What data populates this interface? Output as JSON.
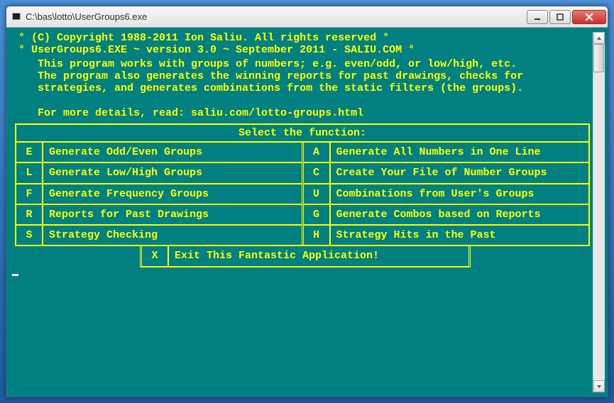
{
  "window": {
    "title": "C:\\bas\\lotto\\UserGroups6.exe"
  },
  "copyright": " ° (C) Copyright 1988-2011 Ion Saliu. All rights reserved °\n ° UserGroups6.EXE ~ version 3.0 ~ September 2011 - SALIU.COM °",
  "description": "    This program works with groups of numbers; e.g. even/odd, or low/high, etc.\n    The program also generates the winning reports for past drawings, checks for\n    strategies, and generates combinations from the static filters (the groups).\n\n    For more details, read: saliu.com/lotto-groups.html",
  "menu": {
    "header": "Select the function:",
    "left": [
      {
        "key": "E",
        "label": "Generate Odd/Even Groups"
      },
      {
        "key": "L",
        "label": "Generate Low/High Groups"
      },
      {
        "key": "F",
        "label": "Generate Frequency Groups"
      },
      {
        "key": "R",
        "label": "Reports for Past Drawings"
      },
      {
        "key": "S",
        "label": "Strategy Checking"
      }
    ],
    "right": [
      {
        "key": "A",
        "label": "Generate All Numbers in One Line"
      },
      {
        "key": "C",
        "label": "Create Your File of Number Groups"
      },
      {
        "key": "U",
        "label": "Combinations from User's Groups"
      },
      {
        "key": "G",
        "label": "Generate Combos based on Reports"
      },
      {
        "key": "H",
        "label": "Strategy Hits in the Past"
      }
    ],
    "exit": {
      "key": "X",
      "label": "Exit This Fantastic Application!"
    }
  }
}
